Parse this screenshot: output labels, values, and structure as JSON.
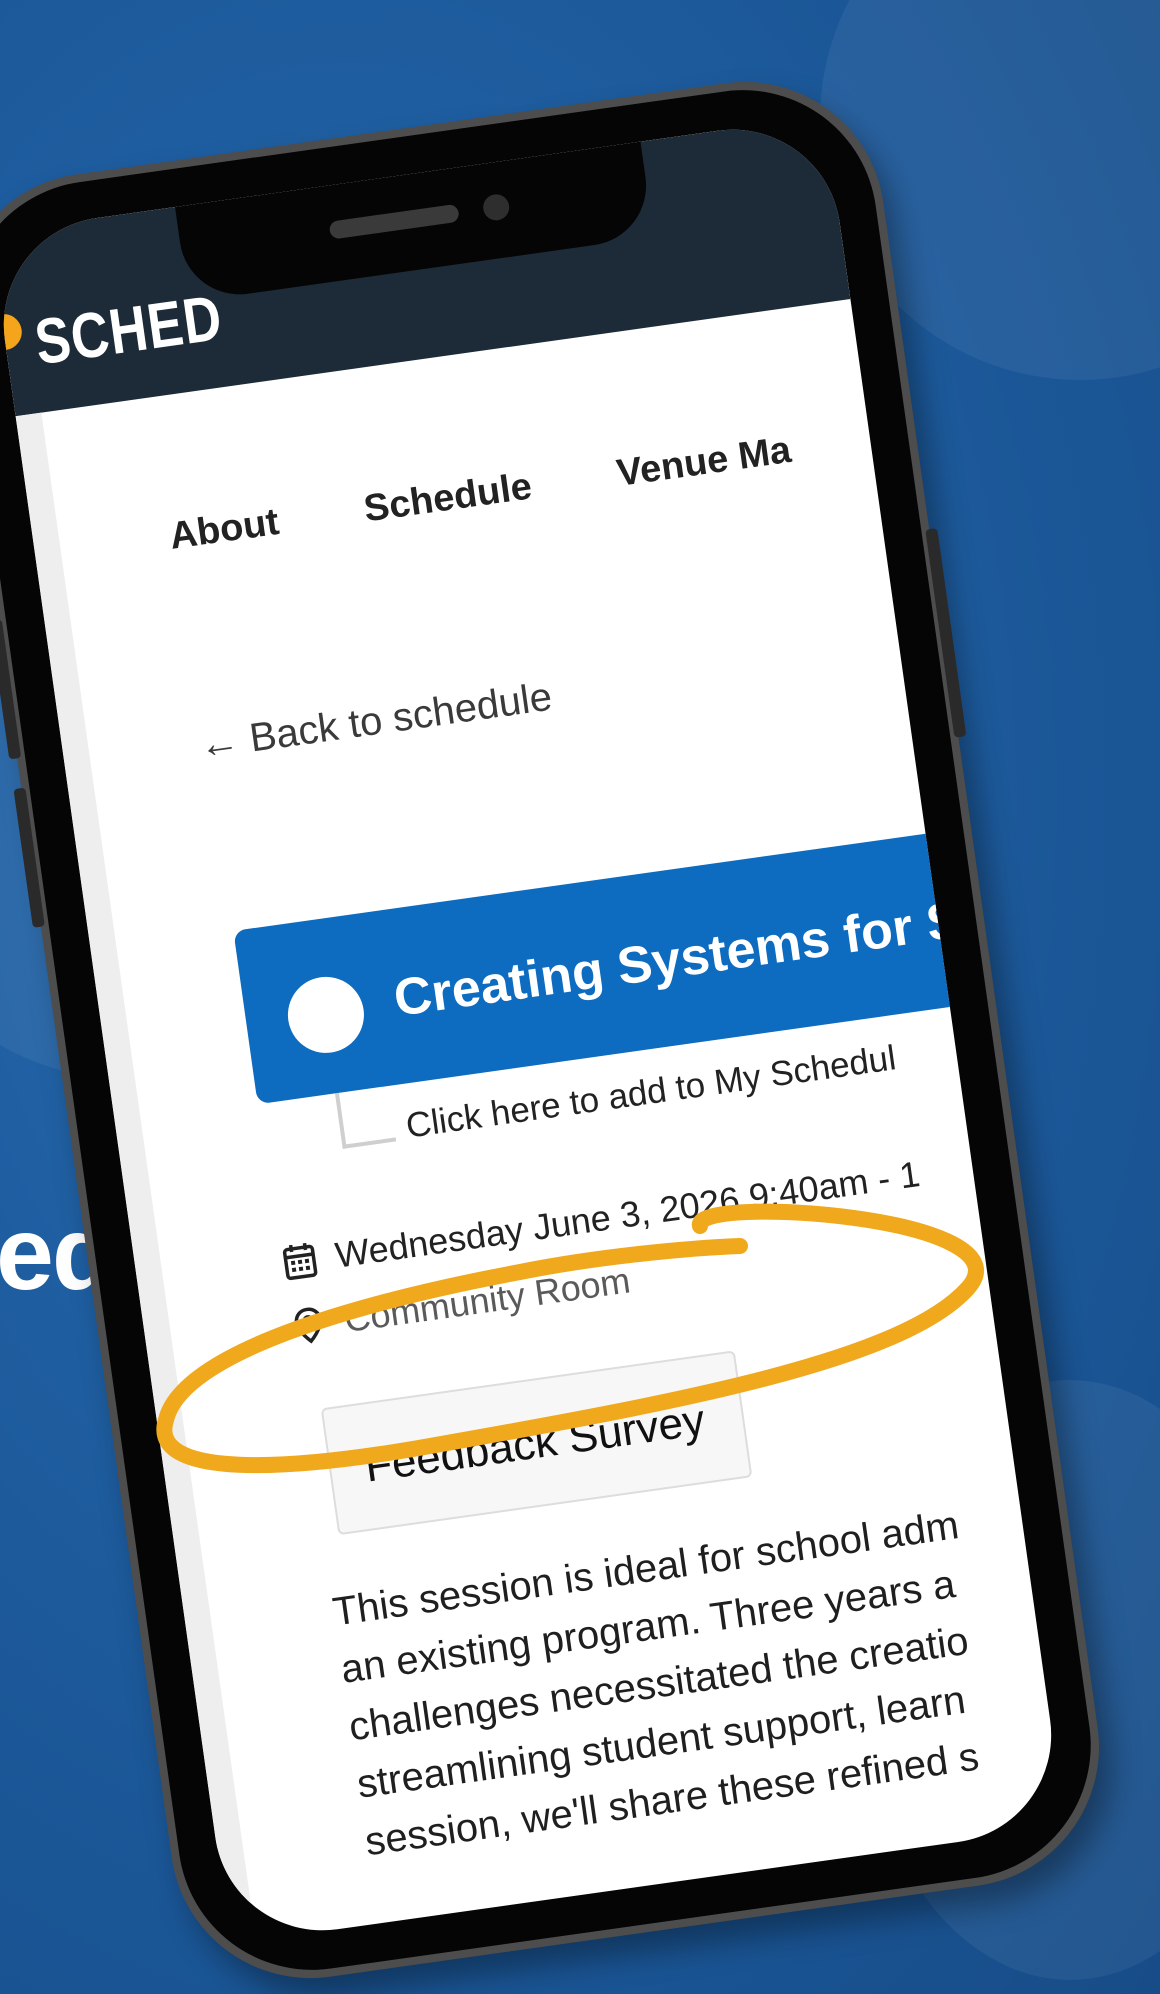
{
  "app": {
    "logo_text": "SCHED",
    "brand_dot_color": "#f4a51c",
    "header_color": "#1d2a38",
    "accent_color": "#0d6bc0"
  },
  "background": {
    "partial_text": "ed"
  },
  "nav": {
    "items": [
      {
        "label": "About"
      },
      {
        "label": "Schedule"
      },
      {
        "label": "Venue Ma"
      }
    ]
  },
  "back_link": "← Back to schedule",
  "session": {
    "title": "Creating Systems for S",
    "add_to_schedule": "Click here to add to My Schedul",
    "datetime": "Wednesday June 3, 2026 9:40am - 1",
    "location": "Community Room",
    "calendar_icon": "calendar-icon",
    "location_icon": "location-pin-icon"
  },
  "feedback": {
    "button_label": "Feedback Survey",
    "highlight_color": "#f0a81c"
  },
  "description": {
    "lines": [
      "This session is ideal for school adm",
      "an existing program. Three years a",
      "challenges necessitated the creatio",
      "streamlining student support, learn",
      "session, we'll share these refined s"
    ]
  }
}
